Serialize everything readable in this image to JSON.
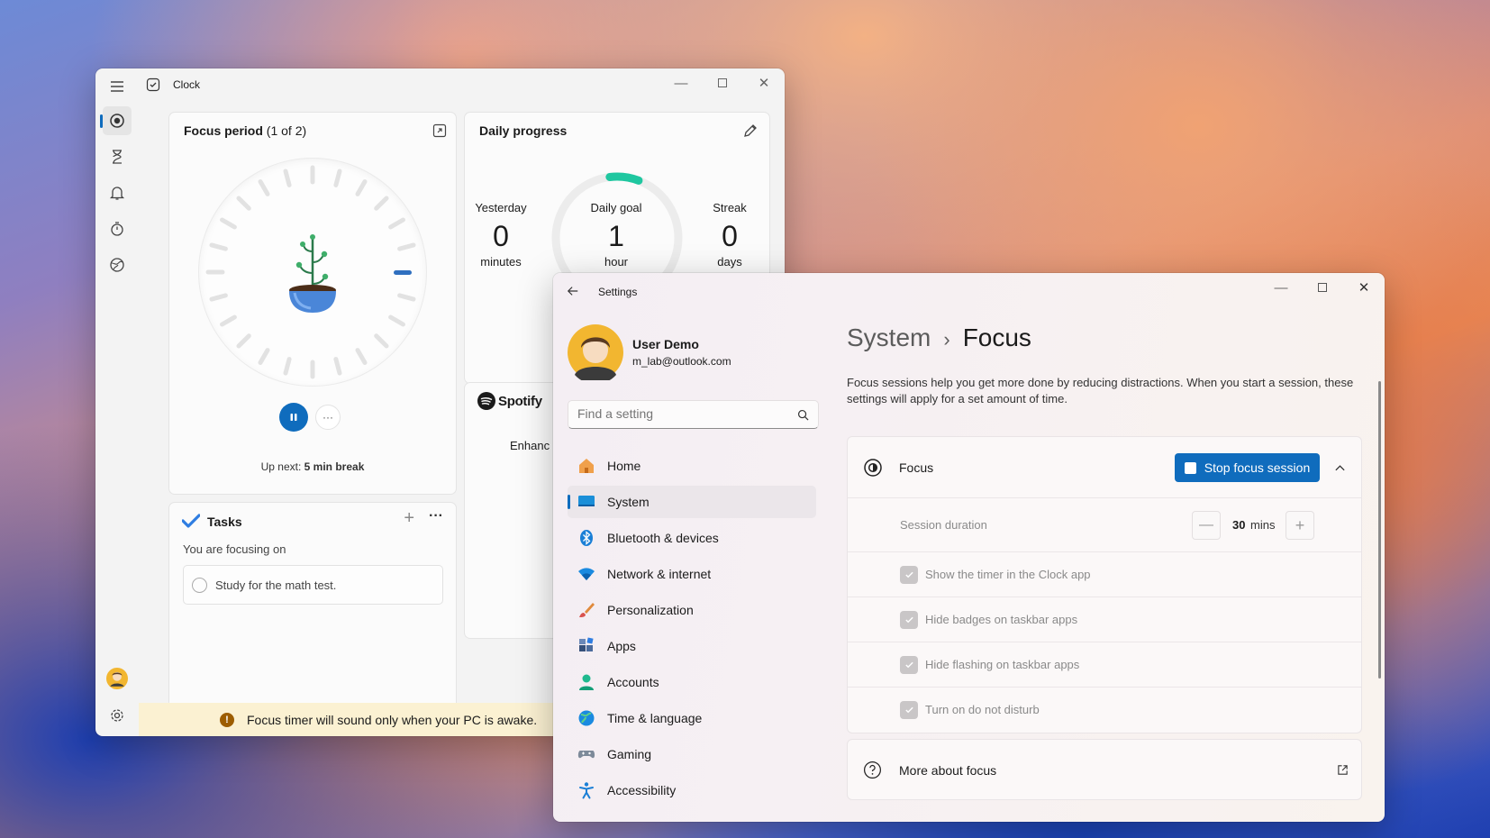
{
  "clock": {
    "title": "Clock",
    "focus_card": {
      "title": "Focus period",
      "subtitle": "(1 of 2)",
      "up_next_prefix": "Up next:",
      "up_next_value": "5 min break",
      "more_label": "···"
    },
    "daily_progress": {
      "title": "Daily progress",
      "yesterday_label": "Yesterday",
      "yesterday_value": "0",
      "yesterday_unit": "minutes",
      "goal_label": "Daily goal",
      "goal_value": "1",
      "goal_unit": "hour",
      "streak_label": "Streak",
      "streak_value": "0",
      "streak_unit": "days"
    },
    "spotify": {
      "brand": "Spotify",
      "text": "Enhanc"
    },
    "tasks": {
      "title": "Tasks",
      "focusing_label": "You are focusing on",
      "task_item": "Study for the math test."
    },
    "banner": "Focus timer will sound only when your PC is awake."
  },
  "settings": {
    "title": "Settings",
    "user_name": "User Demo",
    "user_email": "m_lab@outlook.com",
    "search_placeholder": "Find a setting",
    "nav": [
      {
        "label": "Home",
        "icon": "home-icon"
      },
      {
        "label": "System",
        "icon": "system-icon"
      },
      {
        "label": "Bluetooth & devices",
        "icon": "bluetooth-icon"
      },
      {
        "label": "Network & internet",
        "icon": "wifi-icon"
      },
      {
        "label": "Personalization",
        "icon": "brush-icon"
      },
      {
        "label": "Apps",
        "icon": "apps-icon"
      },
      {
        "label": "Accounts",
        "icon": "accounts-icon"
      },
      {
        "label": "Time & language",
        "icon": "globe-icon"
      },
      {
        "label": "Gaming",
        "icon": "gamepad-icon"
      },
      {
        "label": "Accessibility",
        "icon": "accessibility-icon"
      }
    ],
    "breadcrumb_parent": "System",
    "breadcrumb_sep": "›",
    "breadcrumb_current": "Focus",
    "description": "Focus sessions help you get more done by reducing distractions. When you start a session, these settings will apply for a set amount of time.",
    "focus_label": "Focus",
    "stop_button": "Stop focus session",
    "session_duration_label": "Session duration",
    "session_duration_value": "30",
    "session_duration_unit": "mins",
    "options": [
      {
        "label": "Show the timer in the Clock app",
        "checked": true
      },
      {
        "label": "Hide badges on taskbar apps",
        "checked": true
      },
      {
        "label": "Hide flashing on taskbar apps",
        "checked": true
      },
      {
        "label": "Turn on do not disturb",
        "checked": true
      }
    ],
    "more_about": "More about focus"
  },
  "colors": {
    "accent": "#0f6cbd",
    "progress_teal": "#1fc7a0",
    "banner_bg": "#fbf1d2"
  }
}
